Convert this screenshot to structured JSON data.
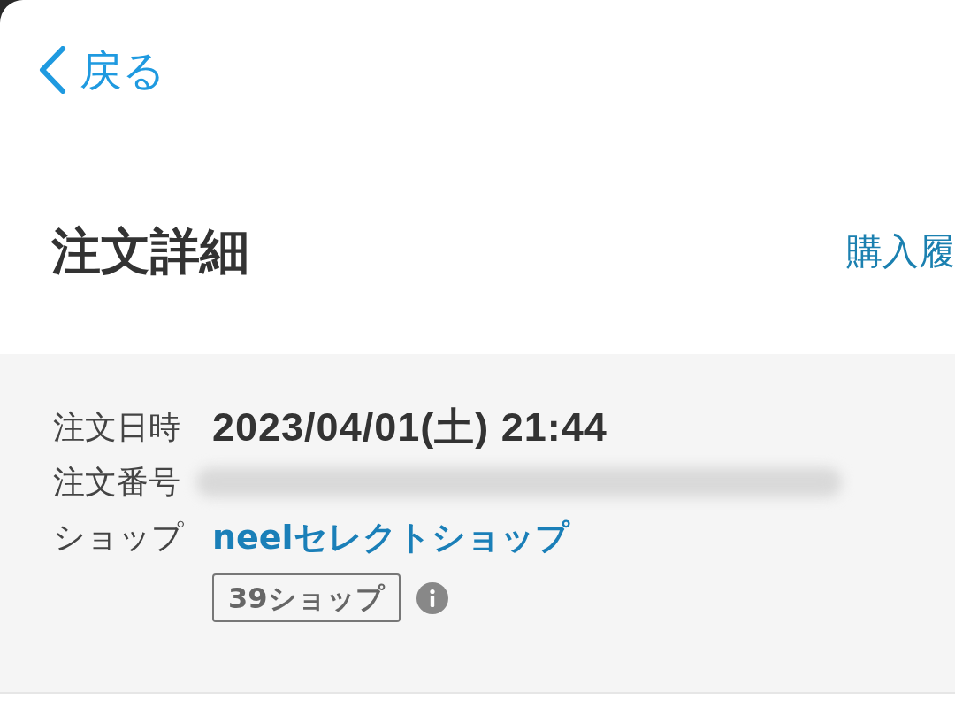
{
  "header": {
    "back_link": "戻る"
  },
  "page": {
    "title": "注文詳細",
    "history_link": "購入履"
  },
  "details": [
    {
      "kind": "text",
      "label": "注文日時",
      "value": "2023/04/01(土) 21:44"
    },
    {
      "kind": "redacted",
      "label": "注文番号"
    },
    {
      "kind": "link",
      "label": "ショップ",
      "value": "neelセレクトショップ",
      "badge": "39ショップ"
    }
  ]
}
